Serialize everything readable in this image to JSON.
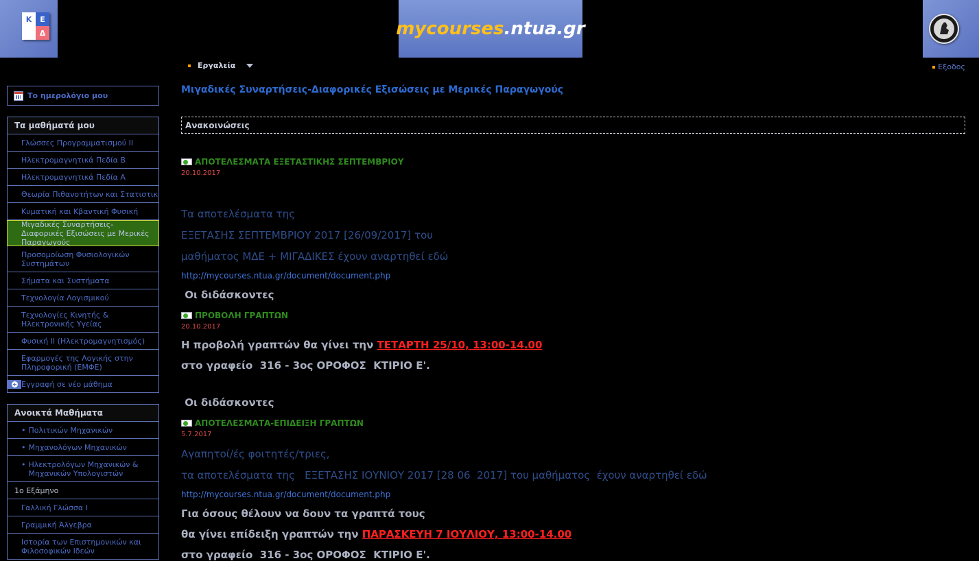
{
  "header": {
    "ked_letters": [
      "Κ",
      "Ε",
      "Δ"
    ],
    "brand_main": "mycourses",
    "brand_suffix": ".ntua.gr"
  },
  "nav": {
    "tools_label": "Εργαλεία",
    "logout_label": "Εξοδος"
  },
  "sidebar": {
    "calendar_label": "Το ημερολόγιο μου",
    "my_courses_title": "Τα μαθήματά μου",
    "my_courses": [
      "Γλώσσες Προγραμματισμού ΙΙ",
      "Ηλεκτρομαγνητικά Πεδία Β",
      "Ηλεκτρομαγνητικά Πεδία Α",
      "Θεωρία Πιθανοτήτων και Στατιστική",
      "Κυματική και Κβαντική Φυσική",
      "Μιγαδικές Συναρτήσεις-Διαφορικές Εξισώσεις με Μερικές Παραγωγούς",
      "Προσομοίωση Φυσιολογικών Συστημάτων",
      "Σήματα και Συστήματα",
      "Τεχνολογία Λογισμικού",
      "Τεχνολογίες Κινητής & Ηλεκτρονικής Υγείας",
      "Φυσική ΙΙ (Ηλεκτρομαγνητισμός)",
      "Εφαρμογές της Λογικής στην Πληροφορική (ΕΜΦΕ)"
    ],
    "enroll_label": "Εγγραφή σε νέο μάθημα",
    "open_courses_title": "Ανοικτά Μαθήματα",
    "open_courses": [
      "Πολιτικών Μηχανικών",
      "Μηχανολόγων Μηχανικών",
      "Ηλεκτρολόγων Μηχανικών & Μηχανικών Υπολογιστών"
    ],
    "semester_label": "1ο Εξάμηνο",
    "semester_courses": [
      "Γαλλική Γλώσσα Ι",
      "Γραμμική Άλγεβρα",
      "Ιστορία των Επιστημονικών και Φιλοσοφικών Ιδεών"
    ]
  },
  "main": {
    "course_title": "Μιγαδικές Συναρτήσεις-Διαφορικές Εξισώσεις με Μερικές Παραγωγούς",
    "announcements_header": "Ανακοινώσεις",
    "ann1": {
      "title": "ΑΠΟΤΕΛΕΣΜΑΤΑ ΕΞΕΤΑΣΤΙΚΗΣ ΣΕΠΤΕΜΒΡΙΟΥ",
      "date": "20.10.2017",
      "line1": "Τα αποτελέσματα της",
      "line2": "ΕΞΕΤΑΣΗΣ ΣΕΠΤΕΜΒΡΙΟΥ 2017 [26/09/2017] του",
      "line3": "μαθήματος ΜΔΕ + ΜΙΓΑΔΙΚΕΣ έχουν αναρτηθεί εδώ",
      "link": "http://mycourses.ntua.gr/document/document.php",
      "signature": " Οι διδάσκοντες"
    },
    "ann2": {
      "title": "ΠΡΟΒΟΛΗ ΓΡΑΠΤΩΝ",
      "date": "20.10.2017",
      "line1_prefix": "Η προβολή γραπτών θα γίνει την ",
      "line1_highlight": "ΤΕΤΑΡΤΗ 25/10, 13:00-14.00",
      "line2": "στο γραφείο  316 - 3ος ΟΡΟΦΟΣ  ΚΤΙΡΙΟ Ε'.",
      "signature": " Οι διδάσκοντες"
    },
    "ann3": {
      "title": "ΑΠΟΤΕΛΕΣΜΑΤΑ-ΕΠΙΔΕΙΞΗ ΓΡΑΠΤΩΝ",
      "date": "5.7.2017",
      "line1": "Αγαπητοί/ές φοιτητές/τριες,",
      "line2": "τα αποτελέσματα της   ΕΞΕΤΑΣΗΣ ΙΟΥΝΙΟΥ 2017 [28 06  2017] του μαθήματος  έχουν αναρτηθεί εδώ",
      "link": "http://mycourses.ntua.gr/document/document.php",
      "line3": "Για όσους θέλουν να δουν τα γραπτά τους",
      "line4_prefix": "θα γίνει επίδειξη γραπτών την ",
      "line4_highlight": "ΠΑΡΑΣΚΕΥΗ 7 ΙΟΥΛΙΟΥ, 13:00-14.00",
      "line5": "στο γραφείο  316 - 3ος ΟΡΟΦΟΣ  ΚΤΙΡΙΟ Ε'."
    }
  }
}
